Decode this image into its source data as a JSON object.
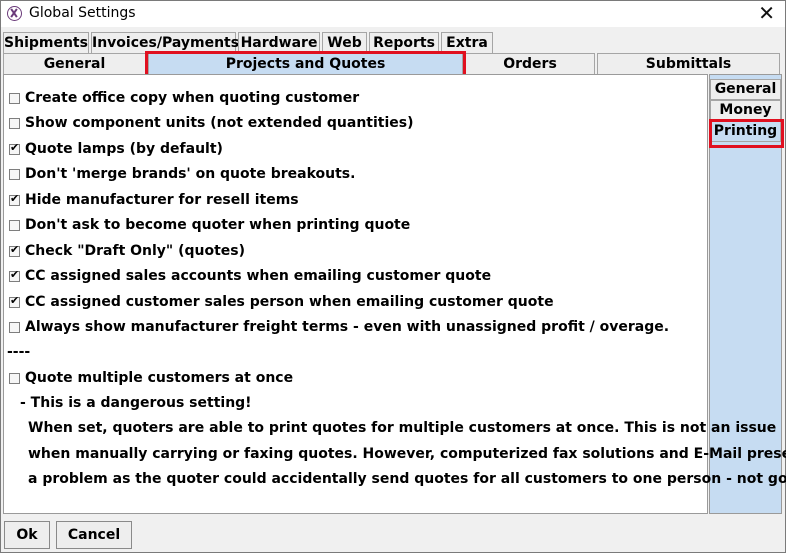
{
  "window": {
    "title": "Global Settings"
  },
  "tabs_row1": [
    {
      "label": "Shipments"
    },
    {
      "label": "Invoices/Payments"
    },
    {
      "label": "Hardware"
    },
    {
      "label": "Web"
    },
    {
      "label": "Reports"
    },
    {
      "label": "Extra"
    }
  ],
  "tabs_row2": [
    {
      "label": "General"
    },
    {
      "label": "Projects and Quotes",
      "selected": true
    },
    {
      "label": "Orders"
    },
    {
      "label": "Submittals"
    }
  ],
  "side_tabs": [
    {
      "label": "General"
    },
    {
      "label": "Money"
    },
    {
      "label": "Printing",
      "selected": true
    }
  ],
  "options": [
    {
      "label": "Create office copy when quoting customer",
      "checked": false
    },
    {
      "label": "Show component units (not extended quantities)",
      "checked": false
    },
    {
      "label": "Quote lamps (by default)",
      "checked": true
    },
    {
      "label": "Don't 'merge brands' on quote breakouts.",
      "checked": false
    },
    {
      "label": "Hide manufacturer for resell items",
      "checked": true
    },
    {
      "label": "Don't ask to become quoter when printing quote",
      "checked": false
    },
    {
      "label": "Check \"Draft Only\" (quotes)",
      "checked": true
    },
    {
      "label": "CC assigned sales accounts when emailing customer quote",
      "checked": true
    },
    {
      "label": "CC assigned customer sales person when emailing customer quote",
      "checked": true
    },
    {
      "label": "Always show  manufacturer freight terms - even with unassigned profit / overage.",
      "checked": false
    }
  ],
  "separator": "----",
  "multi_customer": {
    "label": "Quote multiple customers at once",
    "checked": false
  },
  "warning": {
    "heading": "- This is a dangerous setting!",
    "lines": [
      "When set, quoters are able to print quotes for multiple customers at once.  This is not an issue",
      "when manually carrying or faxing quotes. However, computerized fax solutions and E-Mail presents",
      "a problem as the quoter could accidentally send quotes for all customers to one person - not good!"
    ]
  },
  "buttons": {
    "ok": "Ok",
    "cancel": "Cancel"
  },
  "colors": {
    "selected_tab": "#c6dcf2",
    "highlight": "#e01020"
  }
}
